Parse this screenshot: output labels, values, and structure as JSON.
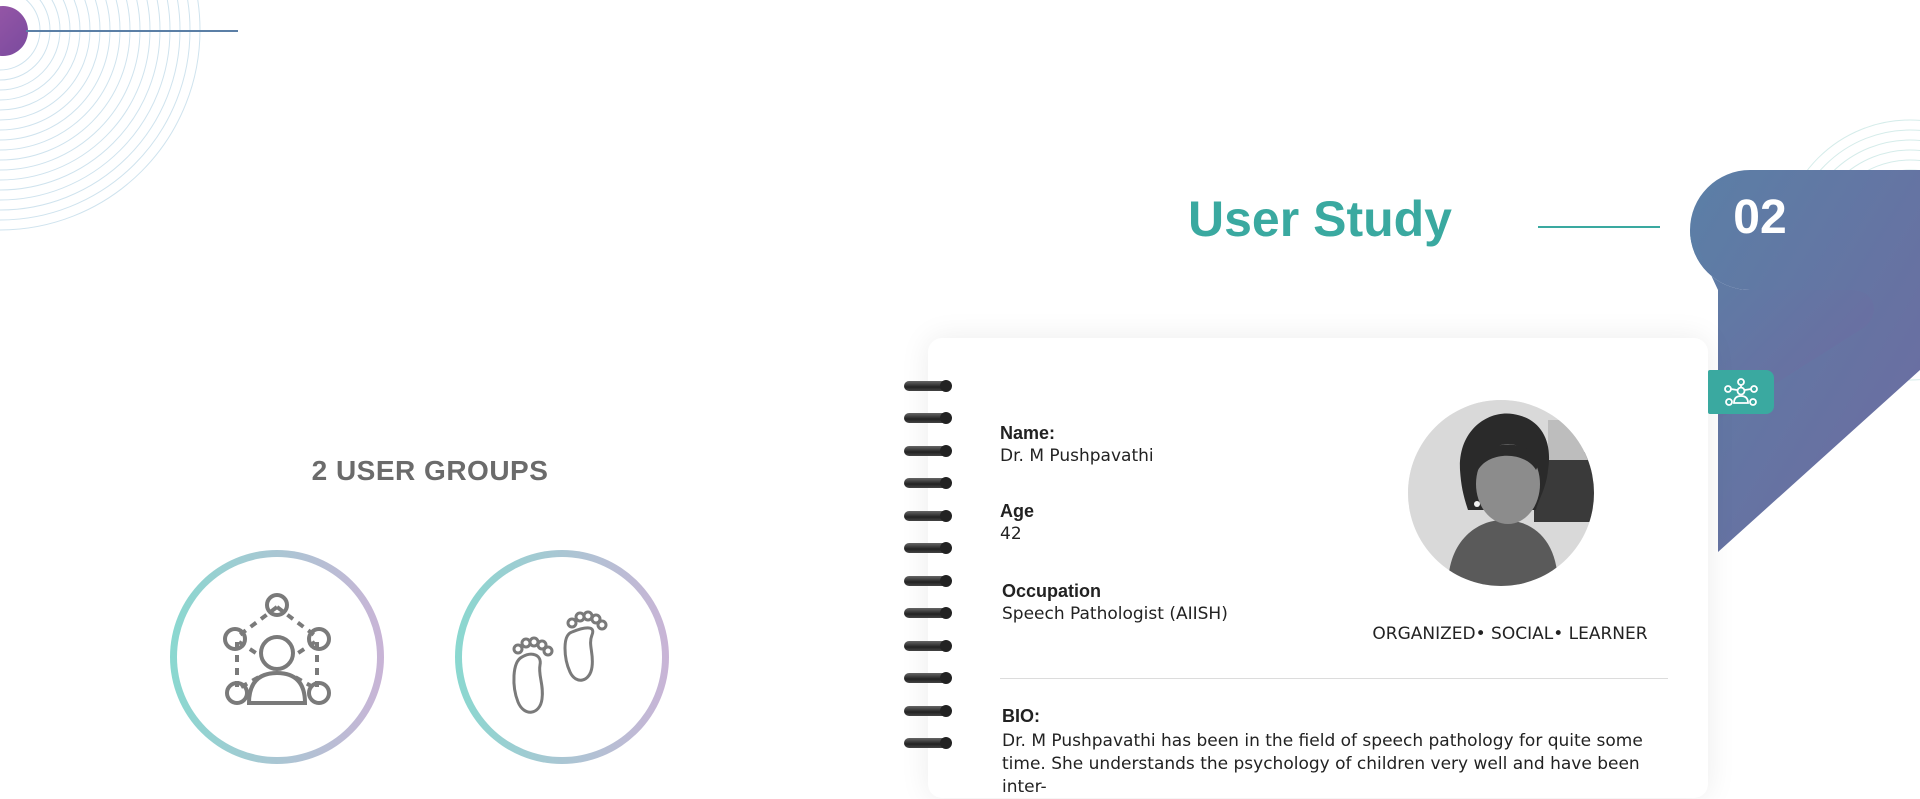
{
  "page": {
    "title": "User Study",
    "section_number": "02"
  },
  "groups": {
    "title": "2 USER GROUPS",
    "icons": [
      "network-user-icon",
      "footprints-icon"
    ]
  },
  "persona": {
    "name_label": "Name:",
    "name_value": "Dr. M Pushpavathi",
    "age_label": "Age",
    "age_value": "42",
    "occupation_label": "Occupation",
    "occupation_value": "Speech Pathologist (AIISH)",
    "traits": "ORGANIZED• SOCIAL• LEARNER",
    "bio_label": "BIO:",
    "bio_text": "Dr. M Pushpavathi has been in the field of speech pathology for quite some time. She understands the psychology of children very well and have been inter-",
    "tag_icon": "team-network-icon"
  },
  "colors": {
    "accent_teal": "#3aa9a0",
    "ribbon_start": "#5b7fa6",
    "ribbon_end": "#6e6aa0",
    "deco_purple": "#9b59a8",
    "group_title": "#6b6b6b"
  }
}
